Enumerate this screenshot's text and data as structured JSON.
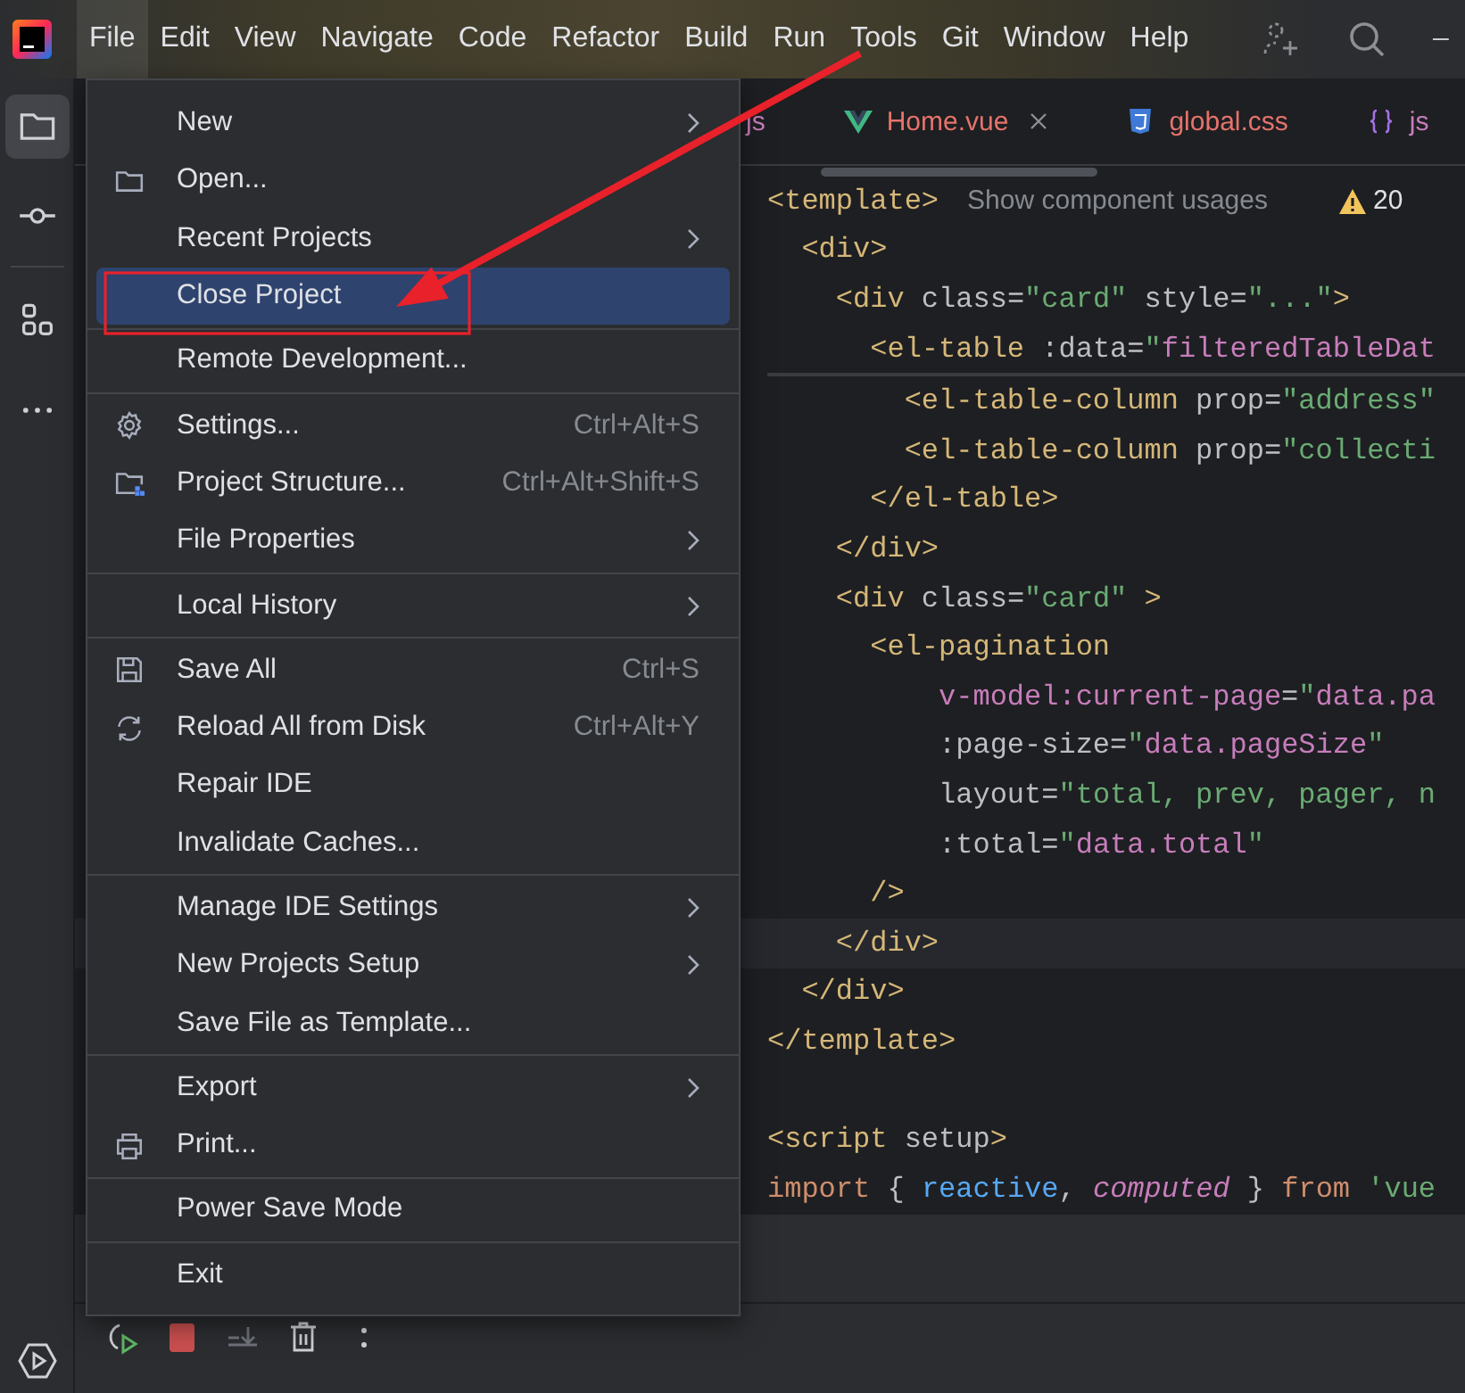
{
  "menubar": [
    {
      "label": "File",
      "selected": true
    },
    {
      "label": "Edit",
      "selected": false
    },
    {
      "label": "View",
      "selected": false
    },
    {
      "label": "Navigate",
      "selected": false
    },
    {
      "label": "Code",
      "selected": false
    },
    {
      "label": "Refactor",
      "selected": false
    },
    {
      "label": "Build",
      "selected": false
    },
    {
      "label": "Run",
      "selected": false
    },
    {
      "label": "Tools",
      "selected": false
    },
    {
      "label": "Git",
      "selected": false
    },
    {
      "label": "Window",
      "selected": false
    },
    {
      "label": "Help",
      "selected": false
    }
  ],
  "tool_strip": [
    {
      "selected": true
    },
    {
      "selected": false
    },
    {
      "selected": false
    },
    {
      "selected": false
    }
  ],
  "tabs": [
    {
      "label": "js",
      "color": "#c77dbb",
      "selected": false
    },
    {
      "label": "Home.vue",
      "color": "#e5736b",
      "selected": true
    },
    {
      "label": "global.css",
      "color": "#e5736b",
      "selected": false
    },
    {
      "label": "js",
      "color": "#c77dbb",
      "selected": false
    }
  ],
  "editor": {
    "inlay": "Show component usages",
    "warnings": "20",
    "sticky_lines": [
      {
        "text": "<template>",
        "current": false
      },
      {
        "text": "  <div>",
        "current": false
      },
      {
        "text": "    <div class=\"card\" style=\"...\">",
        "current": false
      },
      {
        "text": "      <el-table :data=\"filteredTableDat",
        "current": false
      }
    ],
    "lines": [
      {
        "text": "        <el-table-column prop=\"address\"",
        "current": false
      },
      {
        "text": "        <el-table-column prop=\"collecti",
        "current": false
      },
      {
        "text": "      </el-table>",
        "current": false
      },
      {
        "text": "    </div>",
        "current": false
      },
      {
        "text": "    <div class=\"card\" >",
        "current": false
      },
      {
        "text": "      <el-pagination",
        "current": false
      },
      {
        "text": "          v-model:current-page=\"data.pa",
        "current": false
      },
      {
        "text": "          :page-size=\"data.pageSize\"",
        "current": false
      },
      {
        "text": "          layout=\"total, prev, pager, n",
        "current": false
      },
      {
        "text": "          :total=\"data.total\"",
        "current": false
      },
      {
        "text": "      />",
        "current": false
      },
      {
        "text": "    </div>",
        "current": true
      },
      {
        "text": "  </div>",
        "current": false
      },
      {
        "text": "</template>",
        "current": false
      },
      {
        "current": false
      },
      {
        "text": "<script setup>",
        "current": false
      },
      {
        "text": "import { reactive, computed } from 'vue",
        "current": false
      }
    ]
  },
  "file_menu": [
    {
      "kind": "item",
      "label": "New",
      "submenu": true,
      "selected": false
    },
    {
      "kind": "item",
      "label": "Open...",
      "selected": false
    },
    {
      "kind": "item",
      "label": "Recent Projects",
      "submenu": true,
      "selected": false
    },
    {
      "kind": "item",
      "label": "Close Project",
      "selected": true
    },
    {
      "kind": "separator"
    },
    {
      "kind": "item",
      "label": "Remote Development...",
      "selected": false
    },
    {
      "kind": "separator"
    },
    {
      "kind": "item",
      "label": "Settings...",
      "shortcut": "Ctrl+Alt+S",
      "selected": false
    },
    {
      "kind": "item",
      "label": "Project Structure...",
      "shortcut": "Ctrl+Alt+Shift+S",
      "selected": false
    },
    {
      "kind": "item",
      "label": "File Properties",
      "submenu": true,
      "selected": false
    },
    {
      "kind": "separator"
    },
    {
      "kind": "item",
      "label": "Local History",
      "submenu": true,
      "selected": false
    },
    {
      "kind": "separator"
    },
    {
      "kind": "item",
      "label": "Save All",
      "shortcut": "Ctrl+S",
      "selected": false
    },
    {
      "kind": "item",
      "label": "Reload All from Disk",
      "shortcut": "Ctrl+Alt+Y",
      "selected": false
    },
    {
      "kind": "item",
      "label": "Repair IDE",
      "selected": false
    },
    {
      "kind": "item",
      "label": "Invalidate Caches...",
      "selected": false
    },
    {
      "kind": "separator"
    },
    {
      "kind": "item",
      "label": "Manage IDE Settings",
      "submenu": true,
      "selected": false
    },
    {
      "kind": "item",
      "label": "New Projects Setup",
      "submenu": true,
      "selected": false
    },
    {
      "kind": "item",
      "label": "Save File as Template...",
      "selected": false
    },
    {
      "kind": "separator"
    },
    {
      "kind": "item",
      "label": "Export",
      "submenu": true,
      "selected": false
    },
    {
      "kind": "item",
      "label": "Print...",
      "selected": false
    },
    {
      "kind": "separator"
    },
    {
      "kind": "item",
      "label": "Power Save Mode",
      "selected": false
    },
    {
      "kind": "separator"
    },
    {
      "kind": "item",
      "label": "Exit",
      "selected": false
    }
  ]
}
